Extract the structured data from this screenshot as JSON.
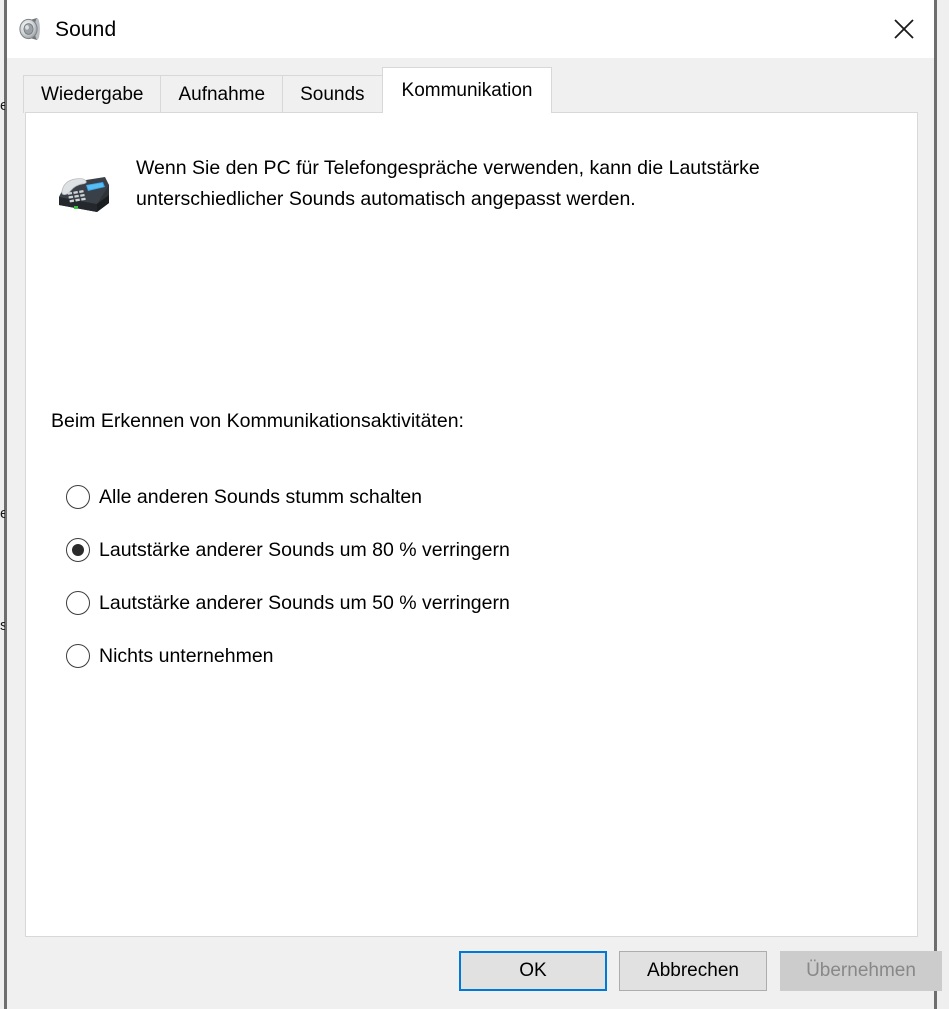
{
  "window": {
    "title": "Sound",
    "icon": "speaker-icon",
    "close_label": "×"
  },
  "tabs": [
    {
      "label": "Wiedergabe",
      "active": false
    },
    {
      "label": "Aufnahme",
      "active": false
    },
    {
      "label": "Sounds",
      "active": false
    },
    {
      "label": "Kommunikation",
      "active": true
    }
  ],
  "content": {
    "icon": "telephone-icon",
    "description": "Wenn Sie den PC für Telefongespräche verwenden, kann die Lautstärke unterschiedlicher Sounds automatisch angepasst werden.",
    "section_label": "Beim Erkennen von Kommunikationsaktivitäten:",
    "options": [
      {
        "label": "Alle anderen Sounds stumm schalten",
        "checked": false
      },
      {
        "label": "Lautstärke anderer Sounds um 80 % verringern",
        "checked": true
      },
      {
        "label": "Lautstärke anderer Sounds um 50 % verringern",
        "checked": false
      },
      {
        "label": "Nichts unternehmen",
        "checked": false
      }
    ]
  },
  "footer": {
    "ok_label": "OK",
    "cancel_label": "Abbrechen",
    "apply_label": "Übernehmen",
    "apply_disabled": true
  },
  "background": {
    "glyph_1": "e",
    "glyph_2": "e",
    "glyph_3": "s"
  },
  "colors": {
    "accent": "#0078d7",
    "dialog_bg": "#f0f0f0",
    "panel_bg": "#ffffff",
    "button_bg": "#e1e1e1",
    "disabled_text": "#888888"
  }
}
